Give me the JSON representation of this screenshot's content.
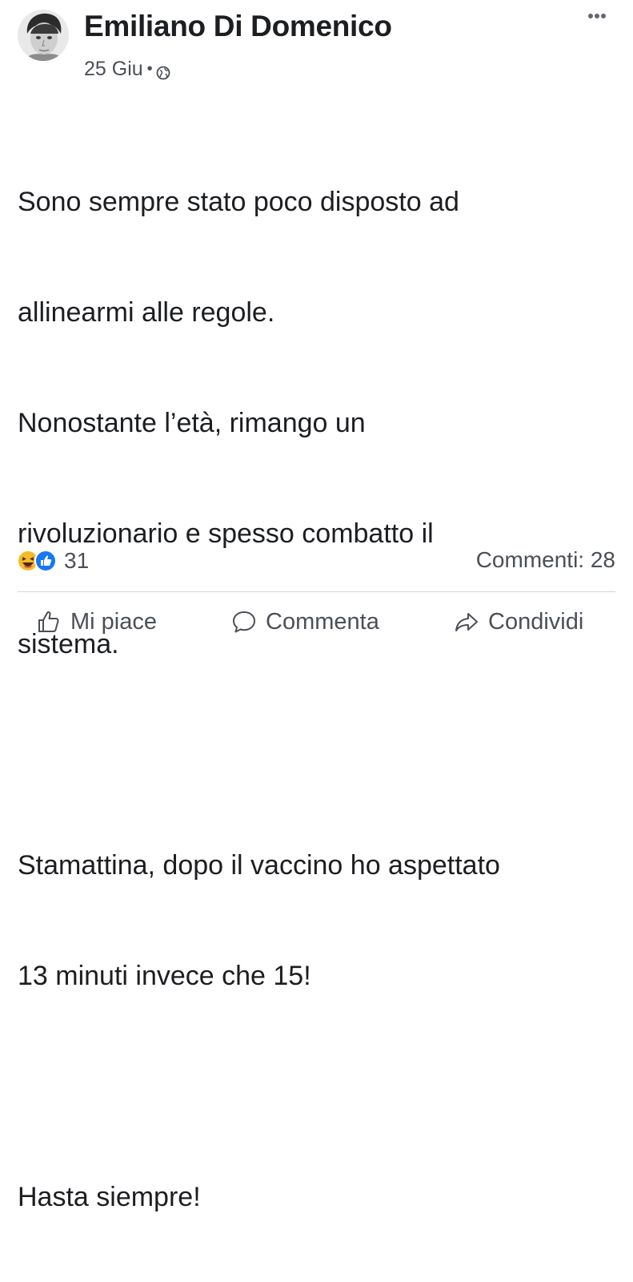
{
  "post": {
    "author": "Emiliano Di Domenico",
    "date": "25 Giu",
    "separator": "•",
    "privacy_icon": "globe-icon",
    "more_icon": "more-options-icon",
    "body_lines": [
      "Sono sempre stato poco disposto ad",
      "allinearmi alle regole.",
      "Nonostante l’età, rimango un",
      "rivoluzionario e spesso combatto il",
      "sistema.",
      "",
      "Stamattina, dopo il vaccino ho aspettato",
      "13 minuti invece che 15!",
      "",
      "Hasta siempre!"
    ]
  },
  "reactions": {
    "icons": [
      "haha-reaction-icon",
      "like-reaction-icon"
    ],
    "count": "31"
  },
  "comments": {
    "label": "Commenti: 28"
  },
  "actions": {
    "like_label": "Mi piace",
    "comment_label": "Commenta",
    "share_label": "Condividi"
  },
  "colors": {
    "text": "#1c1e21",
    "secondary": "#4b4f56",
    "like_blue": "#1877f2",
    "haha_yellow": "#f7b928",
    "divider": "#d4d6da"
  }
}
